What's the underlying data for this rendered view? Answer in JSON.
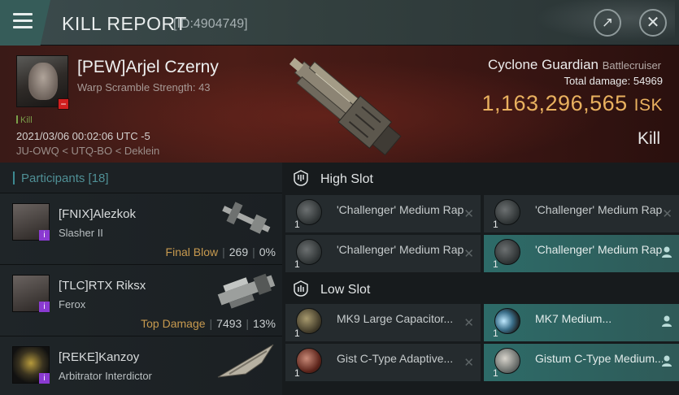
{
  "header": {
    "title": "KILL REPORT",
    "report_id": "[ID:4904749]",
    "share_icon": "↗",
    "close_icon": "✕"
  },
  "victim": {
    "name": "[PEW]Arjel Czerny",
    "warp_scramble": "Warp Scramble Strength: 43",
    "tag": "Kill",
    "timestamp": "2021/03/06 00:02:06 UTC -5",
    "location": "JU-OWQ < UTQ-BO < Deklein",
    "ship_name": "Cyclone Guardian",
    "ship_class": "Battlecruiser",
    "total_damage_label": "Total damage:",
    "total_damage": "54969",
    "isk_value": "1,163,296,565",
    "isk_unit": "ISK",
    "result": "Kill"
  },
  "participants": {
    "label": "Participants",
    "count": "[18]",
    "items": [
      {
        "name": "[FNIX]Alezkok",
        "ship": "Slasher II",
        "role": "Final Blow",
        "damage": "269",
        "percent": "0%"
      },
      {
        "name": "[TLC]RTX Riksx",
        "ship": "Ferox",
        "role": "Top Damage",
        "damage": "7493",
        "percent": "13%"
      },
      {
        "name": "[REKE]Kanzoy",
        "ship": "Arbitrator Interdictor",
        "role": "",
        "damage": "",
        "percent": ""
      }
    ]
  },
  "fitting": {
    "high_slot": {
      "title": "High Slot",
      "modules": [
        {
          "name": "'Challenger' Medium Rapid...",
          "qty": "1",
          "status": "destroyed"
        },
        {
          "name": "'Challenger' Medium Rapid...",
          "qty": "1",
          "status": "destroyed"
        },
        {
          "name": "'Challenger' Medium Rapid...",
          "qty": "1",
          "status": "destroyed"
        },
        {
          "name": "'Challenger' Medium Rapid...",
          "qty": "1",
          "status": "dropped"
        }
      ]
    },
    "low_slot": {
      "title": "Low Slot",
      "modules": [
        {
          "name": "MK9 Large Capacitor...",
          "qty": "1",
          "status": "destroyed"
        },
        {
          "name": "MK7 Medium...",
          "qty": "1",
          "status": "dropped"
        },
        {
          "name": "Gist C-Type Adaptive...",
          "qty": "1",
          "status": "destroyed"
        },
        {
          "name": "Gistum C-Type Medium...",
          "qty": "1",
          "status": "dropped"
        }
      ]
    }
  },
  "colors": {
    "accent_teal": "#2d6b68",
    "isk_gold": "#e9b15f",
    "role_gold": "#c79a4f",
    "victim_red": "#4c1d17"
  }
}
